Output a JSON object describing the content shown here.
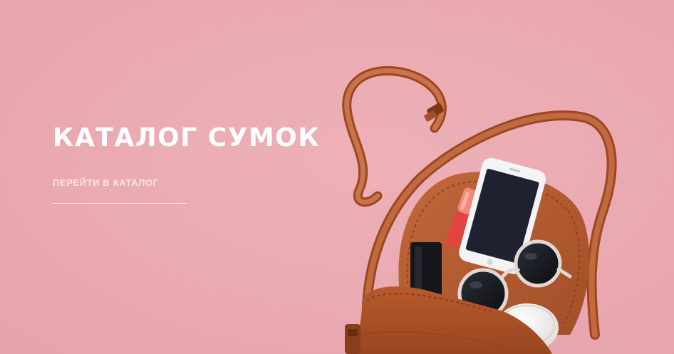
{
  "banner": {
    "title": "КАТАЛОГ СУМОК",
    "link_label": "ПЕРЕЙТИ В КАТАЛОГ"
  },
  "colors": {
    "background": "#eaaab2",
    "bag_leather": "#b65b33",
    "text": "#ffffff"
  },
  "icons": [
    "bag-photo"
  ]
}
